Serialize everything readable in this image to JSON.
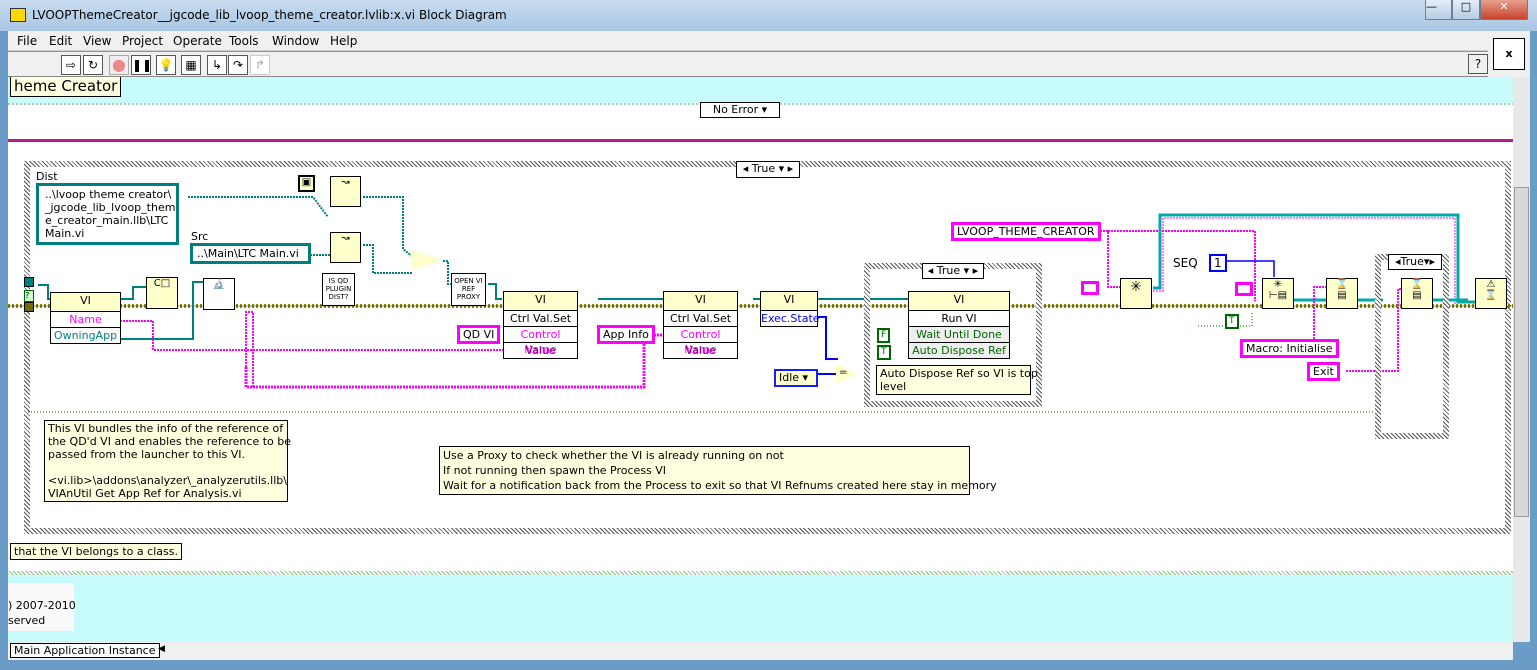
{
  "window": {
    "title": "LVOOPThemeCreator__jgcode_lib_lvoop_theme_creator.lvlib:x.vi Block Diagram",
    "controls": [
      "minimize",
      "maximize",
      "close"
    ]
  },
  "menu": [
    "File",
    "Edit",
    "View",
    "Project",
    "Operate",
    "Tools",
    "Window",
    "Help"
  ],
  "toolbar": {
    "buttons": [
      "run-icon",
      "run-continuously-icon",
      "abort-icon",
      "pause-icon",
      "highlight-execution-icon",
      "retain-wire-values-icon",
      "step-into-icon",
      "step-over-icon",
      "step-out-icon"
    ],
    "help": "?"
  },
  "diagram": {
    "header_label": "heme Creator",
    "error_case": "No Error",
    "outer_case": "True",
    "dist_label": "Dist",
    "dist_path": "..\\lvoop theme creator\\\n_jgcode_lib_lvoop_them\ne_creator_main.llb\\LTC\nMain.vi",
    "src_label": "Src",
    "src_path": "..\\Main\\LTC Main.vi",
    "prop_node1": {
      "class": "VI",
      "items": [
        "Name",
        "OwningApp"
      ]
    },
    "is_qd_plugin": "IS QD PLUGIN DIST?",
    "open_vi_proxy": "OPEN VI REF PROXY",
    "invoke1": {
      "class": "VI",
      "method": "Ctrl Val.Set",
      "items": [
        "Control Name",
        "Value"
      ],
      "const": "QD VI"
    },
    "invoke2": {
      "class": "VI",
      "method": "Ctrl Val.Set",
      "items": [
        "Control Name",
        "Value"
      ],
      "const": "App Info"
    },
    "prop_node2": {
      "class": "VI",
      "items": [
        "Exec.State"
      ]
    },
    "idle_enum": "Idle",
    "inner_case": "True",
    "run_vi": {
      "class": "VI",
      "method": "Run VI",
      "items": [
        "Wait Until Done",
        "Auto Dispose Ref"
      ],
      "consts": [
        "F",
        "T"
      ]
    },
    "run_comment": "Auto Dispose Ref so VI is top\nlevel",
    "queue_name": "LVOOP_THEME_CREATOR",
    "seq_label": "SEQ",
    "seq_value": "1",
    "macro": "Macro: Initialise",
    "exit": "Exit",
    "right_case": "True",
    "comment1": "This VI bundles the info of the reference of\nthe QD'd VI and enables the reference to be\npassed from the launcher to this VI.\n\n<vi.lib>\\addons\\analyzer\\_analyzerutils.llb\\\nVIAnUtil Get App Ref for Analysis.vi",
    "comment2": "Use a Proxy to check whether the VI is already running on not\nIf not running then spawn the Process VI\nWait for a notification back from the Process to exit so that VI Refnums created here stay in memory",
    "comment3": "that the VI belongs to a class.",
    "copyright": ") 2007-2010\nserved"
  },
  "status": {
    "context": "Main Application Instance"
  },
  "colors": {
    "cyan": "#c8fcfc",
    "string_wire": "#ff00ff",
    "ref_wire": "#007f7f",
    "error_wire": "#8c8c00",
    "comment": "#ffffe0"
  }
}
